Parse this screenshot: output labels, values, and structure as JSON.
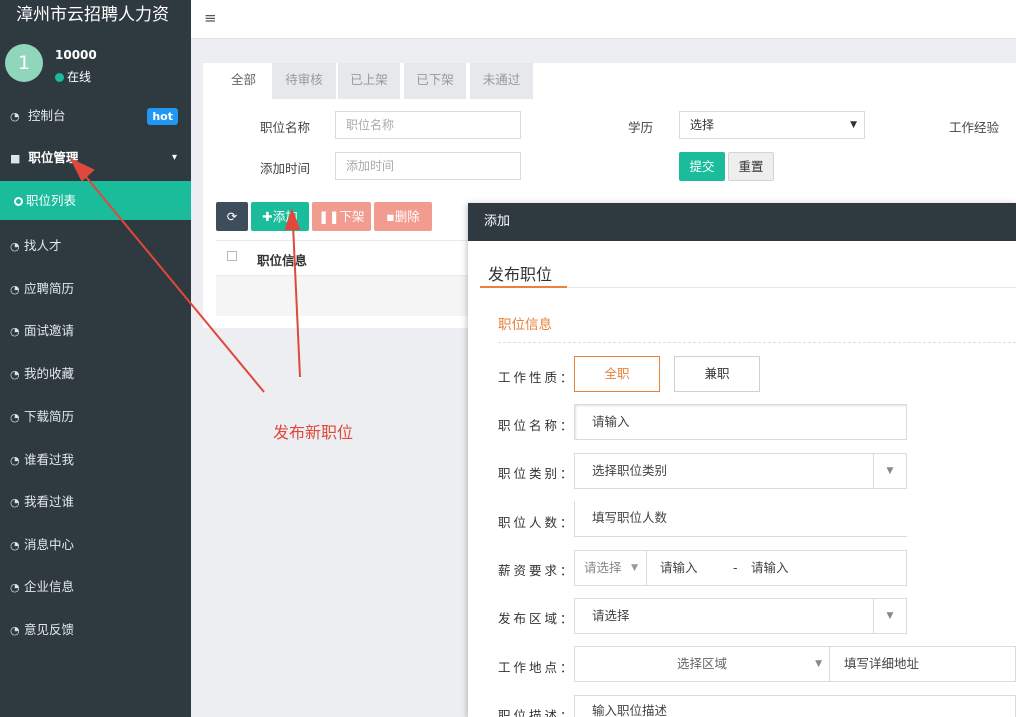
{
  "sidebar": {
    "brand": "漳州市云招聘人力资",
    "avatar_text": "1",
    "user_id": "10000",
    "status": "在线",
    "items": [
      {
        "label": "控制台",
        "badge": "hot"
      },
      {
        "label": "职位管理"
      },
      {
        "label": "职位列表"
      },
      {
        "label": "找人才"
      },
      {
        "label": "应聘简历"
      },
      {
        "label": "面试邀请"
      },
      {
        "label": "我的收藏"
      },
      {
        "label": "下载简历"
      },
      {
        "label": "谁看过我"
      },
      {
        "label": "我看过谁"
      },
      {
        "label": "消息中心"
      },
      {
        "label": "企业信息"
      },
      {
        "label": "意见反馈"
      }
    ]
  },
  "topbar": {
    "menu_icon": "≡"
  },
  "tabs": [
    "全部",
    "待审核",
    "已上架",
    "已下架",
    "未通过"
  ],
  "filters": {
    "job_name_label": "职位名称",
    "job_name_placeholder": "职位名称",
    "education_label": "学历",
    "education_value": "选择",
    "experience_label": "工作经验",
    "add_time_label": "添加时间",
    "add_time_placeholder": "添加时间",
    "submit": "提交",
    "reset": "重置"
  },
  "toolbar": {
    "add": "添加",
    "offline": "下架",
    "delete": "删除"
  },
  "table": {
    "header": "职位信息"
  },
  "annotation": "发布新职位",
  "modal": {
    "header": "添加",
    "title": "发布职位",
    "section": "职位信息",
    "job_type_label": "工作性质：",
    "full_time": "全职",
    "part_time": "兼职",
    "job_name_label": "职位名称：",
    "job_name_value": "请输入",
    "category_label": "职位类别：",
    "category_value": "选择职位类别",
    "headcount_label": "职位人数：",
    "headcount_value": "填写职位人数",
    "salary_label": "薪资要求：",
    "salary_select": "请选择",
    "salary_min": "请输入",
    "salary_dash": "-",
    "salary_max": "请输入",
    "area_label": "发布区域：",
    "area_value": "请选择",
    "location_label": "工作地点：",
    "location_area": "选择区域",
    "location_detail": "填写详细地址",
    "desc_label": "职位描述：",
    "desc_value": "输入职位描述"
  },
  "colors": {
    "accent_green": "#1bbc9b",
    "accent_orange": "#e8813a",
    "sidebar_bg": "#2f3a40",
    "annotation_red": "#e0483c"
  }
}
